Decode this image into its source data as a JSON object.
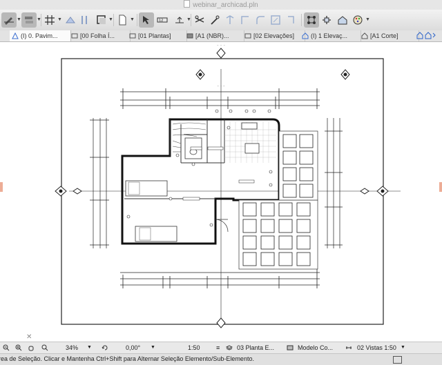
{
  "window": {
    "title": "webinar_archicad.pln"
  },
  "toolbar": {
    "tools": [
      "pencil-icon",
      "layer-stack-icon",
      "grid-snap-icon",
      "ruler-icon",
      "pencil-ruler-icon",
      "selection-arrow-icon",
      "elevation-marker-icon",
      "dimension-icon",
      "trim-icon",
      "magic-wand-icon",
      "split-icon",
      "adjust-icon",
      "fillet-icon",
      "offset-icon",
      "group-icon",
      "move-icon",
      "palette-icon"
    ]
  },
  "tabs": [
    {
      "label": "(I) 0. Pavim...",
      "icon": "floor-plan-icon",
      "active": true
    },
    {
      "label": "[00 Folha Í...",
      "icon": "layout-icon"
    },
    {
      "label": "[01 Plantas]",
      "icon": "layout-icon"
    },
    {
      "label": "[A1 (NBR)...",
      "icon": "layout-icon"
    },
    {
      "label": "[02 Elevações]",
      "icon": "layout-icon"
    },
    {
      "label": "(I) 1 Elevaç...",
      "icon": "house-icon"
    },
    {
      "label": "[A1 Corte]",
      "icon": "house-icon"
    }
  ],
  "navbar": {
    "zoom": "34%",
    "angle": "0,00°",
    "scale": "1:50",
    "layer_combo": "03 Planta E...",
    "model_view": "Modelo Co...",
    "views": "02 Vistas 1:50"
  },
  "statusbar": {
    "text": "rea de Seleção. Clicar e Mantenha Ctrl+Shift para Alternar Seleção Elemento/Sub-Elemento."
  }
}
